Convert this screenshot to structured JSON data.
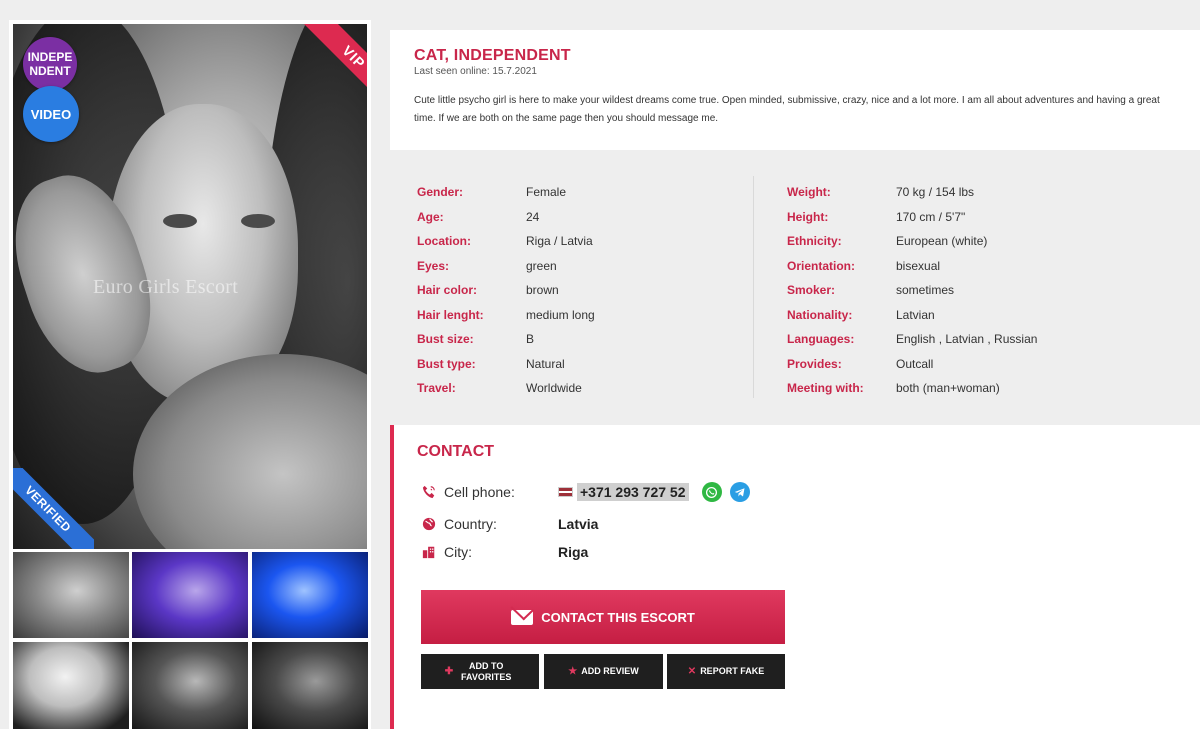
{
  "profile": {
    "name": "CAT, INDEPENDENT",
    "last_seen": "Last seen online: 15.7.2021",
    "description": "Cute little psycho girl is here to make your wildest dreams come true. Open minded, submissive, crazy, nice and a lot more. I am all about adventures and having a great time. If we are both on the same page then you should message me."
  },
  "gallery": {
    "badge_independent": "INDEPE NDENT",
    "badge_video": "VIDEO",
    "vip_label": "VIP",
    "verified_label": "VERIFIED",
    "watermark": "Euro Girls Escort"
  },
  "details": {
    "left": [
      {
        "label": "Gender:",
        "value": "Female"
      },
      {
        "label": "Age:",
        "value": "24"
      },
      {
        "label": "Location:",
        "value": "Riga / Latvia"
      },
      {
        "label": "Eyes:",
        "value": "green"
      },
      {
        "label": "Hair color:",
        "value": "brown"
      },
      {
        "label": "Hair lenght:",
        "value": "medium long"
      },
      {
        "label": "Bust size:",
        "value": "B"
      },
      {
        "label": "Bust type:",
        "value": "Natural"
      },
      {
        "label": "Travel:",
        "value": "Worldwide"
      }
    ],
    "right": [
      {
        "label": "Weight:",
        "value": "70 kg / 154 lbs"
      },
      {
        "label": "Height:",
        "value": "170 cm / 5'7\""
      },
      {
        "label": "Ethnicity:",
        "value": "European (white)"
      },
      {
        "label": "Orientation:",
        "value": "bisexual"
      },
      {
        "label": "Smoker:",
        "value": "sometimes"
      },
      {
        "label": "Nationality:",
        "value": "Latvian"
      },
      {
        "label": "Languages:",
        "value": "English , Latvian , Russian"
      },
      {
        "label": "Provides:",
        "value": "Outcall"
      },
      {
        "label": "Meeting with:",
        "value": "both (man+woman)"
      }
    ]
  },
  "contact": {
    "title": "CONTACT",
    "cell_label": "Cell phone:",
    "phone": "+371 293 727 52",
    "country_label": "Country:",
    "country": "Latvia",
    "city_label": "City:",
    "city": "Riga",
    "contact_button": "CONTACT THIS ESCORT",
    "add_favorites": "ADD TO FAVORITES",
    "add_review": "ADD REVIEW",
    "report_fake": "REPORT FAKE"
  },
  "icons": {
    "phone": "phone-icon",
    "globe": "globe-icon",
    "city": "city-icon",
    "whatsapp": "whatsapp-icon",
    "telegram": "telegram-icon",
    "envelope": "envelope-icon"
  },
  "colors": {
    "accent": "#c8264a",
    "button": "#d32b51",
    "dark_button": "#1f1f1f",
    "independent_badge": "#7b2fa3",
    "video_badge": "#2a7de1",
    "verified_ribbon": "#2b6fd6"
  }
}
